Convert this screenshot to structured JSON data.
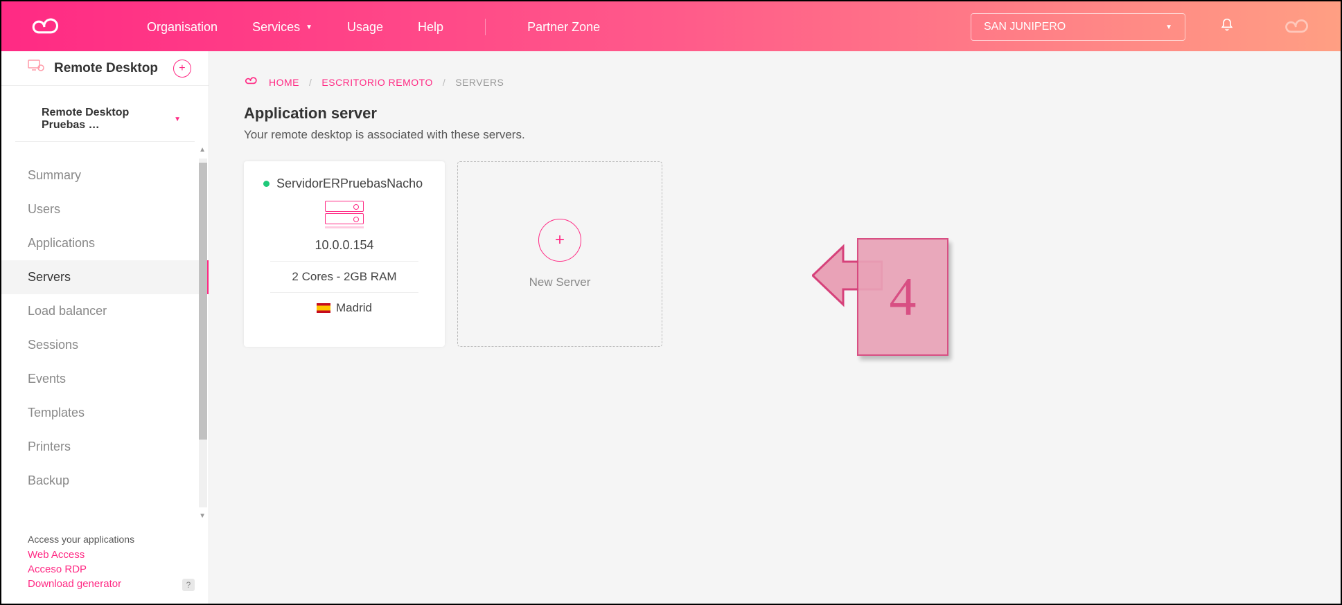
{
  "header": {
    "nav": {
      "organisation": "Organisation",
      "services": "Services",
      "usage": "Usage",
      "help": "Help",
      "partner_zone": "Partner Zone"
    },
    "org_selected": "SAN JUNIPERO"
  },
  "sidebar": {
    "title": "Remote Desktop",
    "subtitle": "Remote Desktop Pruebas …",
    "menu": [
      {
        "label": "Summary"
      },
      {
        "label": "Users"
      },
      {
        "label": "Applications"
      },
      {
        "label": "Servers",
        "active": true
      },
      {
        "label": "Load balancer"
      },
      {
        "label": "Sessions"
      },
      {
        "label": "Events"
      },
      {
        "label": "Templates"
      },
      {
        "label": "Printers"
      },
      {
        "label": "Backup"
      }
    ],
    "footer": {
      "heading": "Access your applications",
      "web_access": "Web Access",
      "acceso_rdp": "Acceso RDP",
      "download_gen": "Download generator",
      "help_badge": "?"
    }
  },
  "breadcrumb": {
    "home": "HOME",
    "level2": "ESCRITORIO REMOTO",
    "current": "SERVERS"
  },
  "page": {
    "title": "Application server",
    "subtitle": "Your remote desktop is associated with these servers."
  },
  "server_card": {
    "name": "ServidorERPruebasNacho",
    "ip": "10.0.0.154",
    "specs": "2 Cores - 2GB RAM",
    "location": "Madrid"
  },
  "new_server": {
    "label": "New Server"
  },
  "annotation": {
    "step": "4"
  }
}
